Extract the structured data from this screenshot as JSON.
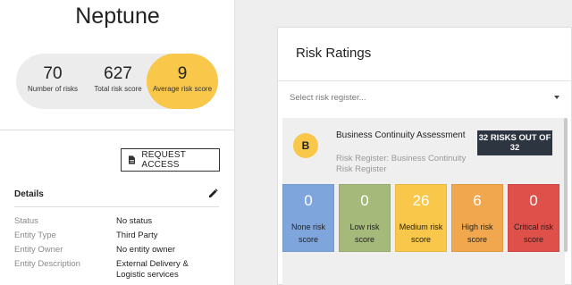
{
  "entity": {
    "name": "Neptune",
    "stats": [
      {
        "value": "70",
        "label": "Number of risks"
      },
      {
        "value": "627",
        "label": "Total risk score"
      },
      {
        "value": "9",
        "label": "Average risk score"
      }
    ],
    "request_access_label": "REQUEST ACCESS",
    "details_heading": "Details",
    "details": [
      {
        "key": "Status",
        "value": "No status"
      },
      {
        "key": "Entity Type",
        "value": "Third Party"
      },
      {
        "key": "Entity Owner",
        "value": "No entity owner"
      },
      {
        "key": "Entity Description",
        "value": "External Delivery & Logistic services"
      }
    ]
  },
  "risk_ratings": {
    "title": "Risk Ratings",
    "select_placeholder": "Select risk register...",
    "register": {
      "badge_letter": "B",
      "title": "Business Continuity Assessment",
      "subtitle": "Risk Register: Business Continuity Risk Register",
      "count_badge": "32 RISKS OUT OF 32",
      "tiles": [
        {
          "value": "0",
          "label": "None risk score",
          "color": "#7fa6dc"
        },
        {
          "value": "0",
          "label": "Low risk score",
          "color": "#a5b97a"
        },
        {
          "value": "26",
          "label": "Medium risk score",
          "color": "#f9c74a"
        },
        {
          "value": "6",
          "label": "High risk score",
          "color": "#f0a74e"
        },
        {
          "value": "0",
          "label": "Critical risk score",
          "color": "#e0504a"
        }
      ]
    }
  },
  "icons": {
    "request_access": "document-icon",
    "edit_details": "pencil-icon",
    "select_dropdown": "caret-down-icon"
  }
}
